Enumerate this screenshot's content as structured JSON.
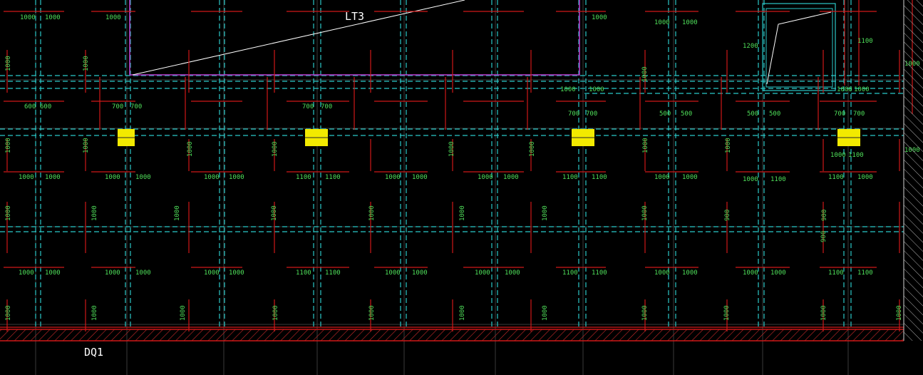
{
  "drawing": {
    "labels": {
      "stair": "LT3",
      "wall": "DQ1"
    },
    "colors": {
      "background": "#000000",
      "rebar": "#d01818",
      "grid": "#2bc9c9",
      "stair_outline": "#b43cc8",
      "column": "#f2ea00",
      "dimension_text": "#4fe05a",
      "label_text": "#ffffff",
      "hatch": "#cc2a2a"
    },
    "dimension_texts": {
      "top": [
        "1000",
        "1000",
        "1000",
        "1000",
        "1000",
        "1000",
        "1200",
        "1100",
        "1000",
        "1000",
        "1000",
        "1000"
      ],
      "mid": [
        "600",
        "600",
        "700",
        "700",
        "700",
        "700",
        "700",
        "700",
        "500",
        "500",
        "500",
        "500",
        "700",
        "700",
        "1000",
        "1000"
      ],
      "row1": [
        "1000",
        "1000",
        "1000",
        "1000",
        "1000",
        "1000",
        "1100",
        "1100",
        "1000",
        "1000",
        "1000",
        "1000",
        "1100",
        "1100",
        "1000",
        "1000",
        "1000",
        "1100",
        "1100",
        "1000",
        "1000",
        "1100"
      ],
      "row2": [
        "1000",
        "1000",
        "1000",
        "1000",
        "1000",
        "1000",
        "1100",
        "1100",
        "1000",
        "1000",
        "1000",
        "1000",
        "1100",
        "1100",
        "1000",
        "1000",
        "1000",
        "1000",
        "1100",
        "1100"
      ],
      "vertical": [
        "1000",
        "1000",
        "1000",
        "1000",
        "1000",
        "1000",
        "1000",
        "1000",
        "1000",
        "1000",
        "1000",
        "1000",
        "900",
        "1000",
        "1000",
        "900",
        "1000",
        "1000",
        "1000",
        "1000",
        "1000",
        "1000",
        "1000",
        "1000",
        "1000",
        "1000",
        "1000",
        "900",
        "1000",
        "1000",
        "1000",
        "1000",
        "1000"
      ]
    }
  }
}
